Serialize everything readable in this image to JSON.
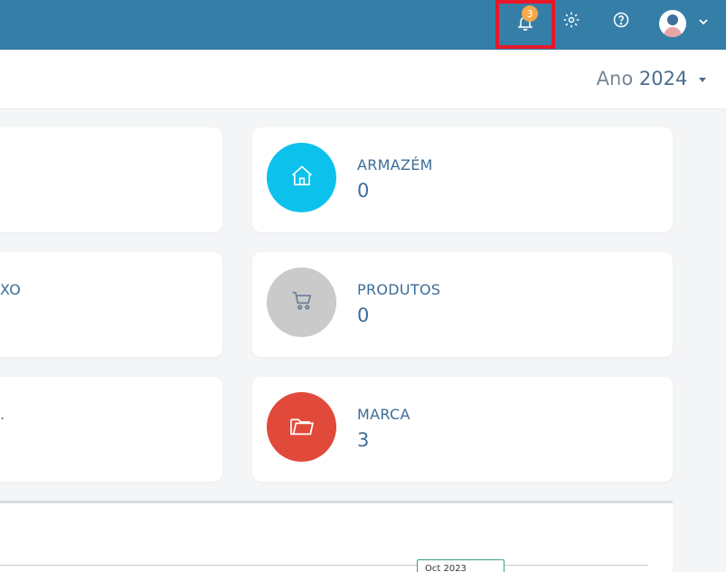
{
  "topbar": {
    "notification_count": "3",
    "icons": [
      "bell-icon",
      "gear-icon",
      "help-icon",
      "avatar",
      "chevron-down-icon"
    ]
  },
  "filter": {
    "prefix": "Ano",
    "year": "2024"
  },
  "cards": {
    "left": [
      {
        "fragment": ""
      },
      {
        "fragment": "XO"
      },
      {
        "fragment": "."
      }
    ],
    "right": [
      {
        "title": "ARMAZÉM",
        "value": "0",
        "icon": "warehouse-icon",
        "color": "#0cc2ec"
      },
      {
        "title": "PRODUTOS",
        "value": "0",
        "icon": "cart-icon",
        "color": "#cacaca"
      },
      {
        "title": "MARCA",
        "value": "3",
        "icon": "folder-icon",
        "color": "#e14a3b"
      }
    ]
  },
  "chart": {
    "tooltip_label": "Oct 2023"
  }
}
